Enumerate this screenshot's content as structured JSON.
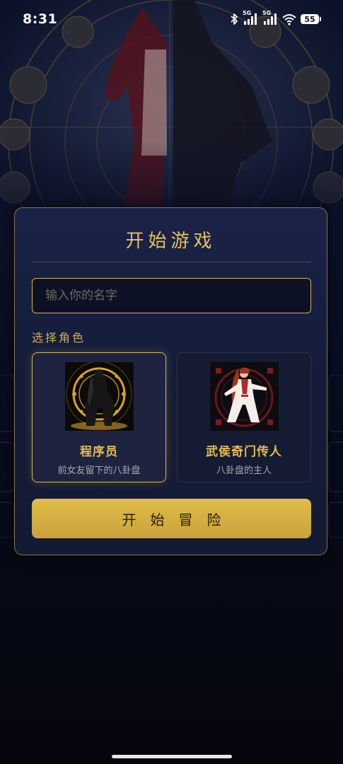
{
  "status_bar": {
    "time": "8:31",
    "network_1": "5G",
    "network_2": "5G",
    "battery": "55",
    "icons": [
      "bluetooth-icon",
      "signal-icon",
      "signal-icon",
      "wifi-icon",
      "battery-icon"
    ]
  },
  "modal": {
    "title": "开始游戏",
    "name_input": {
      "placeholder": "输入你的名字",
      "value": ""
    },
    "role_section_label": "选择角色",
    "roles": [
      {
        "name": "程序员",
        "description": "前女友留下的八卦盘",
        "selected": true
      },
      {
        "name": "武侯奇门传人",
        "description": "八卦盘的主人",
        "selected": false
      }
    ],
    "start_button_label": "开始冒险"
  },
  "colors": {
    "accent_gold": "#e7bd4f",
    "button_gold": "#d9b64d",
    "modal_bg": "#1a2347",
    "page_bg": "#06070f"
  }
}
